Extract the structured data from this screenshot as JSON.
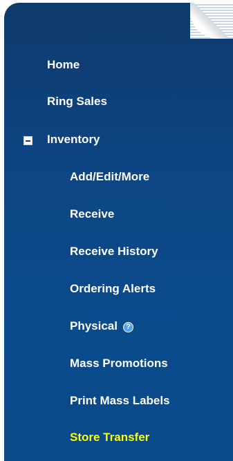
{
  "nav": {
    "home": "Home",
    "ring_sales": "Ring Sales",
    "inventory": "Inventory",
    "inventory_items": [
      "Add/Edit/More",
      "Receive",
      "Receive History",
      "Ordering Alerts",
      "Physical",
      "Mass Promotions",
      "Print Mass Labels",
      "Store Transfer"
    ],
    "active_item": "Store Transfer",
    "help_icon_glyph": "?"
  },
  "colors": {
    "sidebar_bg": "#0d4583",
    "text": "#ffffff",
    "active_text": "#ffff00"
  }
}
